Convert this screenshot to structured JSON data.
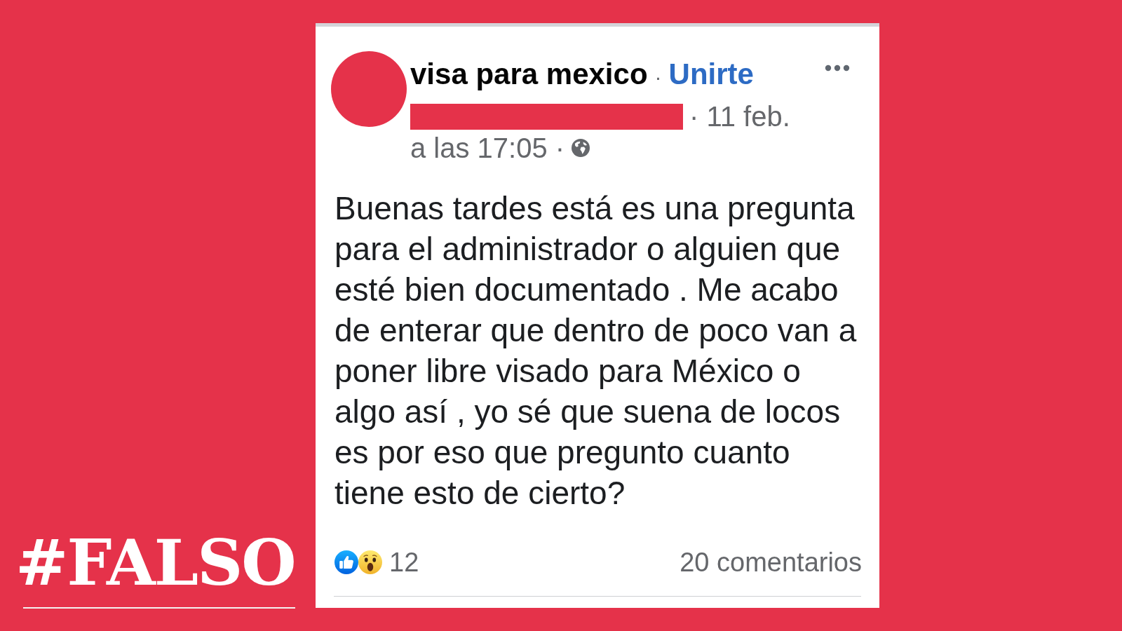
{
  "verdict": {
    "label": "#FALSO"
  },
  "post": {
    "group_name": "visa para mexico",
    "name_separator": "·",
    "join_label": "Unirte",
    "date": "· 11 feb.",
    "time": "a las 17:05 ·",
    "body": "Buenas tardes está es una pregunta para el administrador o alguien que esté bien documentado . Me acabo de enterar que dentro de poco van a poner libre visado para México o algo así , yo sé que suena de locos es por eso que pregunto cuanto tiene esto de cierto?",
    "reactions": [
      {
        "kind": "like"
      },
      {
        "kind": "wow"
      }
    ],
    "reaction_count": "12",
    "comment_count": "20 comentarios"
  }
}
